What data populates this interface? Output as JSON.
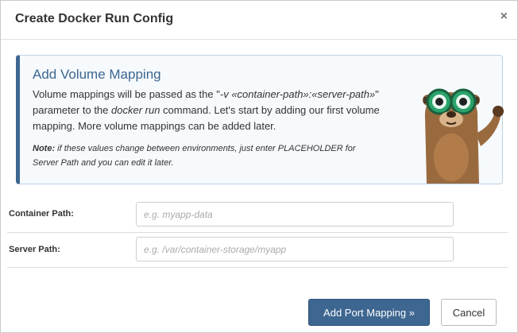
{
  "dialog": {
    "title": "Create Docker Run Config",
    "close_glyph": "×"
  },
  "info": {
    "title": "Add Volume Mapping",
    "body_1": "Volume mappings will be passed as the \"",
    "body_code": "-v «container-path»:«server-path»",
    "body_2": "\" parameter to the ",
    "body_cmd": "docker run",
    "body_3": " command. Let's start by adding our first volume mapping. More volume mappings can be added later.",
    "note_label": "Note:",
    "note_text": " if these values change between environments, just enter PLACEHOLDER for Server Path and you can edit it later.",
    "mascot_icon": "otter-mascot-icon"
  },
  "form": {
    "container_path_label": "Container Path:",
    "container_path_placeholder": "e.g. myapp-data",
    "container_path_value": "",
    "server_path_label": "Server Path:",
    "server_path_placeholder": "e.g. /var/container-storage/myapp",
    "server_path_value": ""
  },
  "footer": {
    "primary_label": "Add Port Mapping »",
    "cancel_label": "Cancel"
  },
  "colors": {
    "accent": "#3d6690",
    "info_background": "#f6fafd"
  }
}
